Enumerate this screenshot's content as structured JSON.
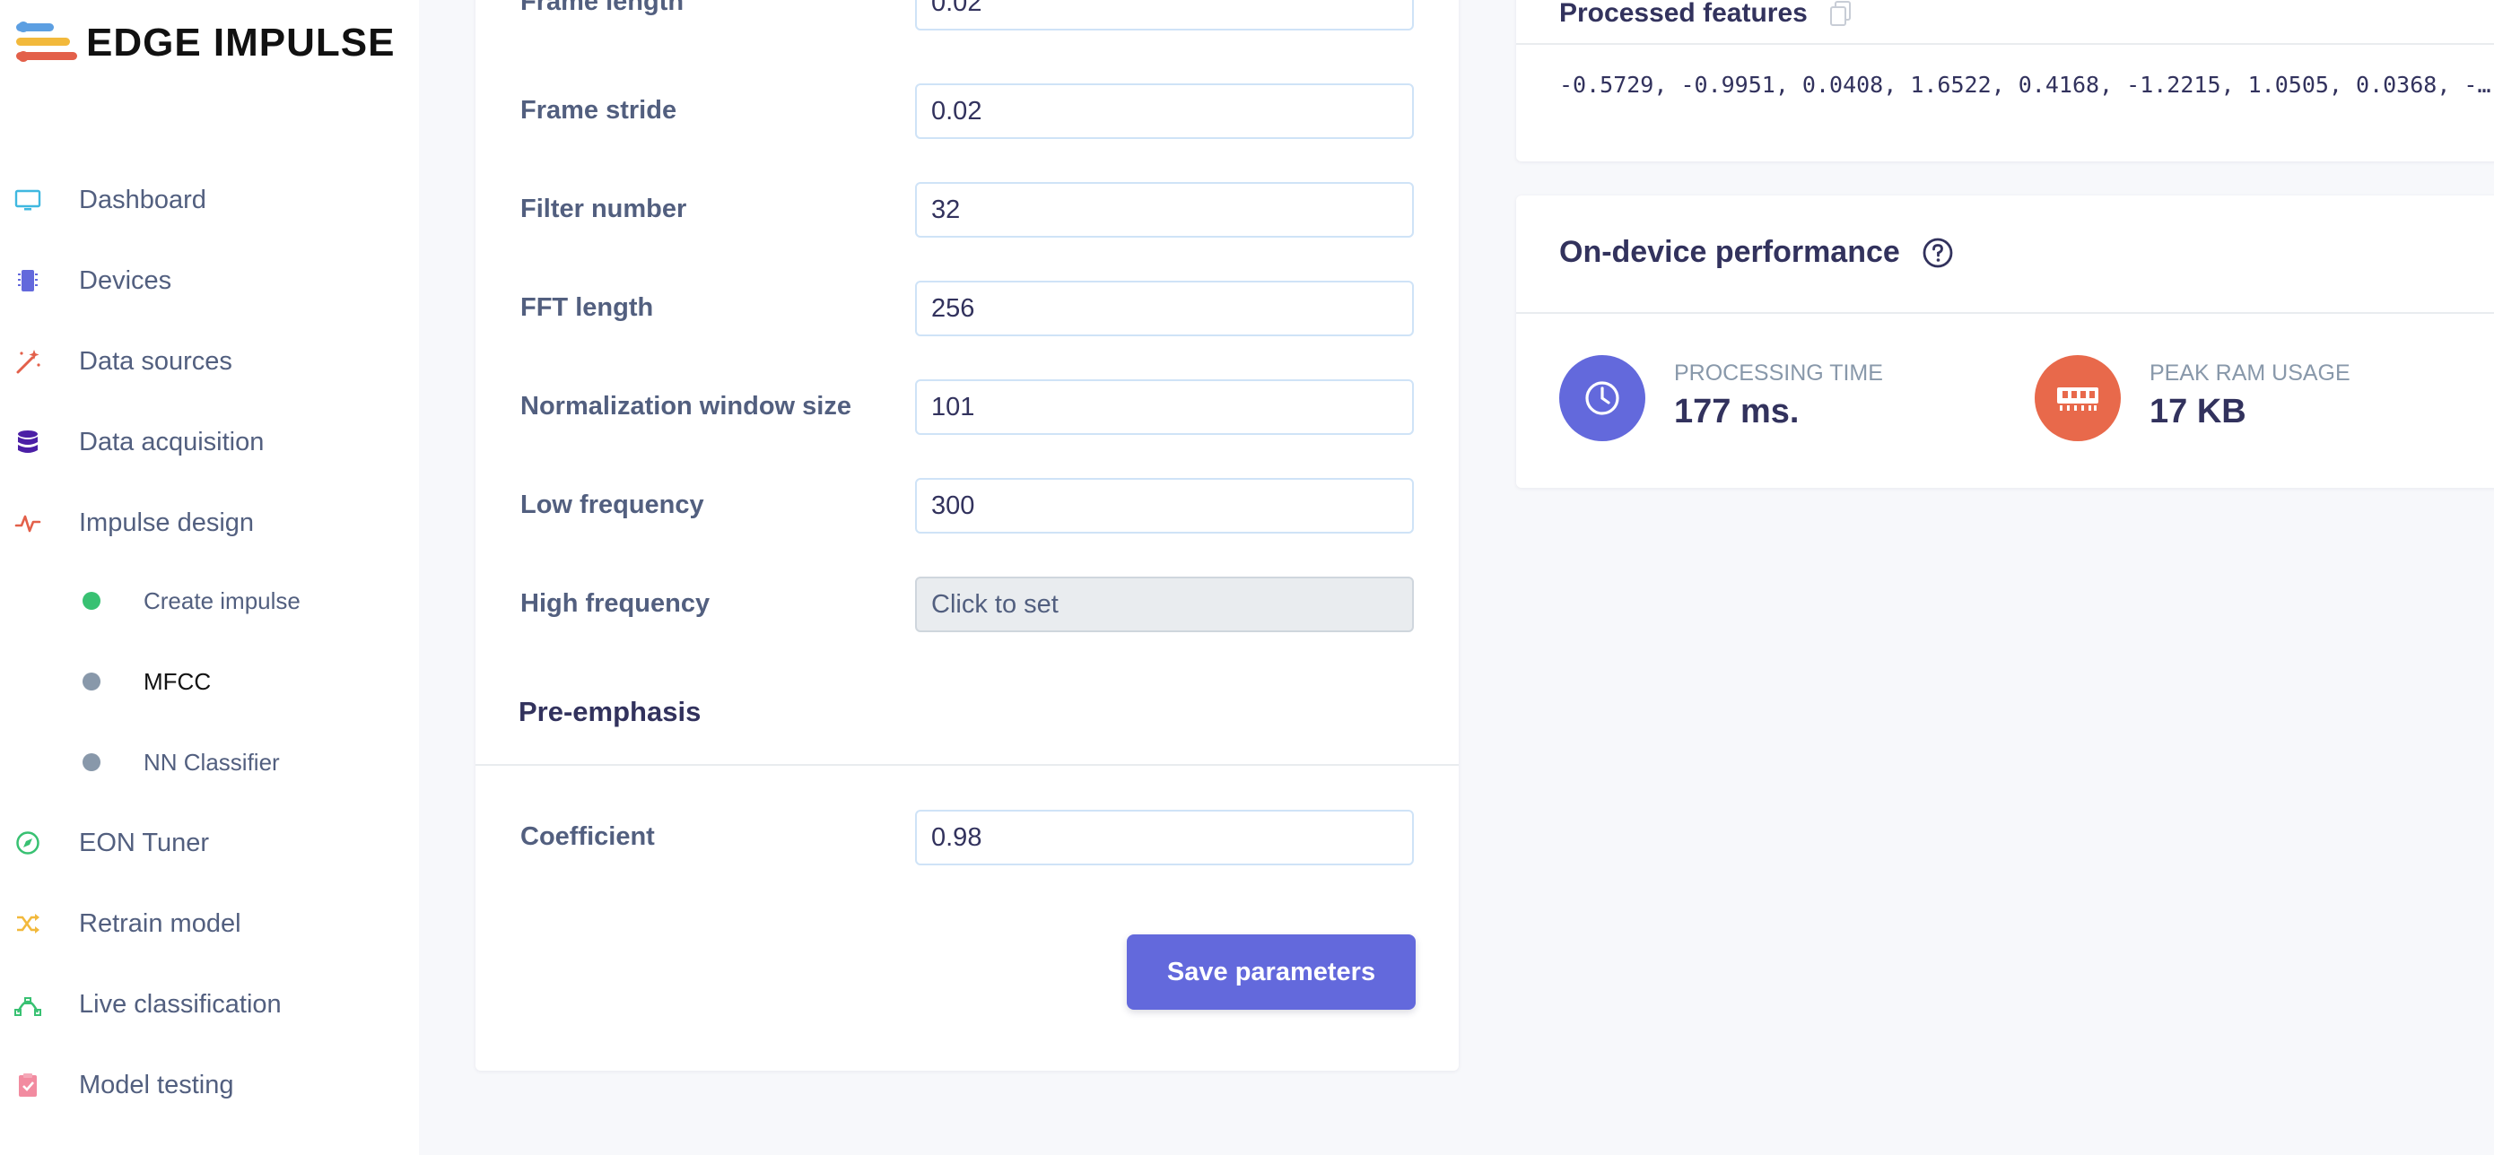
{
  "brand": {
    "name": "EDGE IMPULSE"
  },
  "sidebar": {
    "items": [
      {
        "label": "Dashboard",
        "icon": "monitor-icon",
        "color": "#3fb8e0"
      },
      {
        "label": "Devices",
        "icon": "chip-icon",
        "color": "#6369dc"
      },
      {
        "label": "Data sources",
        "icon": "magic-wand-icon",
        "color": "#e3604a"
      },
      {
        "label": "Data acquisition",
        "icon": "database-icon",
        "color": "#4b1fa6"
      },
      {
        "label": "Impulse design",
        "icon": "pulse-icon",
        "color": "#e3604a"
      },
      {
        "label": "Create impulse",
        "sub": true,
        "status_color": "#38c172"
      },
      {
        "label": "MFCC",
        "sub": true,
        "status_color": "#8898aa",
        "active": true
      },
      {
        "label": "NN Classifier",
        "sub": true,
        "status_color": "#8898aa"
      },
      {
        "label": "EON Tuner",
        "icon": "compass-icon",
        "color": "#38c172"
      },
      {
        "label": "Retrain model",
        "icon": "shuffle-icon",
        "color": "#f2b93c"
      },
      {
        "label": "Live classification",
        "icon": "curve-icon",
        "color": "#38c172"
      },
      {
        "label": "Model testing",
        "icon": "clipboard-check-icon",
        "color": "#f28ba0"
      }
    ]
  },
  "params": {
    "rows": [
      {
        "label": "Frame length",
        "value": "0.02"
      },
      {
        "label": "Frame stride",
        "value": "0.02"
      },
      {
        "label": "Filter number",
        "value": "32"
      },
      {
        "label": "FFT length",
        "value": "256"
      },
      {
        "label": "Normalization window size",
        "value": "101"
      },
      {
        "label": "Low frequency",
        "value": "300"
      },
      {
        "label": "High frequency",
        "value": "Click to set",
        "unset": true
      }
    ],
    "pre_emphasis": {
      "title": "Pre-emphasis",
      "coefficient_label": "Coefficient",
      "coefficient_value": "0.98"
    },
    "save_label": "Save parameters"
  },
  "features": {
    "title": "Processed features",
    "values": "-0.5729, -0.9951, 0.0408, 1.6522, 0.4168, -1.2215, 1.0505, 0.0368, -…"
  },
  "performance": {
    "title": "On-device performance",
    "processing_time_label": "PROCESSING TIME",
    "processing_time_value": "177 ms.",
    "ram_label": "PEAK RAM USAGE",
    "ram_value": "17 KB",
    "time_color": "#6369dc",
    "ram_color": "#e8694b"
  }
}
